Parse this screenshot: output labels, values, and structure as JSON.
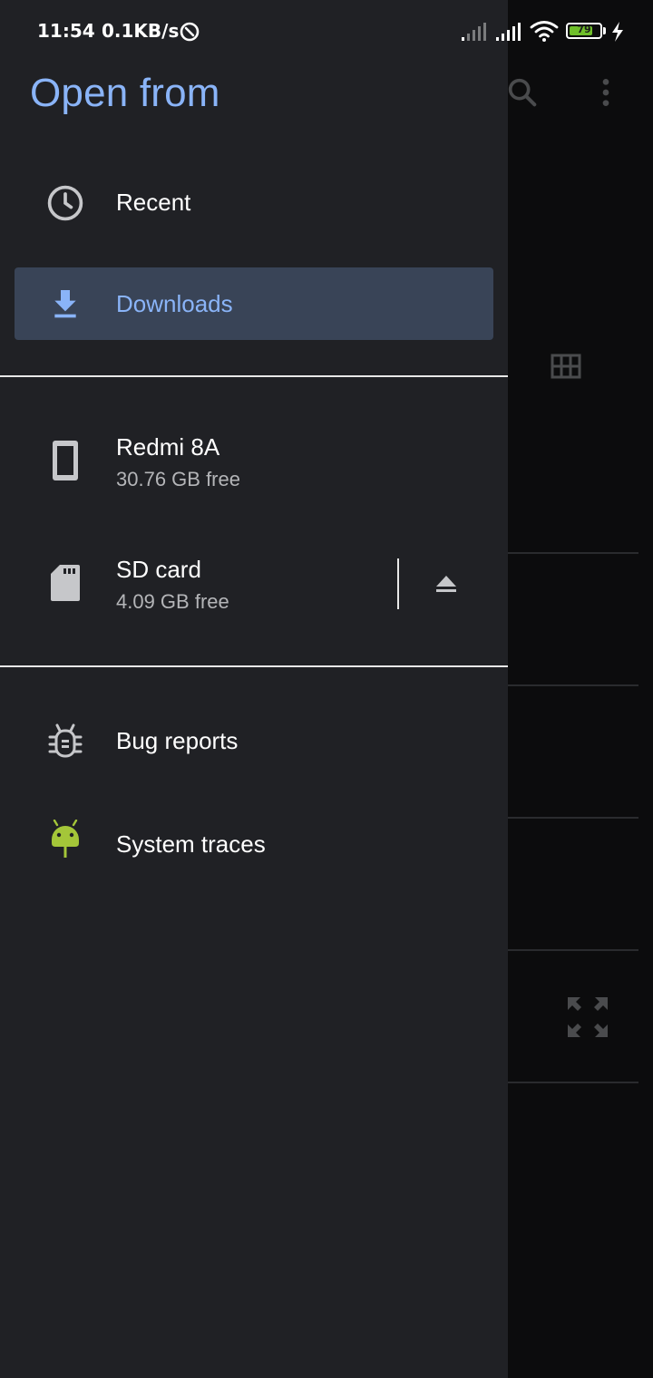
{
  "status_bar": {
    "time": "11:54",
    "speed": "0.1KB/s",
    "battery_level": "79",
    "battery_fraction": 0.79,
    "icons": [
      "data-saver-icon",
      "signal-1-icon",
      "signal-2-icon",
      "wifi-icon",
      "battery-icon",
      "charging-icon"
    ]
  },
  "drawer": {
    "title": "Open from",
    "items": [
      {
        "label": "Recent",
        "icon": "clock-icon"
      },
      {
        "label": "Downloads",
        "icon": "download-icon",
        "selected": true
      },
      {
        "label": "Redmi 8A",
        "sub": "30.76 GB free",
        "icon": "phone-icon"
      },
      {
        "label": "SD card",
        "sub": "4.09 GB free",
        "icon": "sd-card-icon",
        "action_icon": "eject-icon"
      },
      {
        "label": "Bug reports",
        "icon": "bug-icon"
      },
      {
        "label": "System traces",
        "icon": "android-icon"
      }
    ]
  },
  "background_app": {
    "icons": [
      "search-icon",
      "more-vert-icon",
      "grid-view-icon",
      "fullscreen-icon"
    ]
  },
  "colors": {
    "accent": "#8ab4f8",
    "drawer_bg": "#202125",
    "selected_bg": "#394457",
    "android_green": "#a4c639"
  }
}
